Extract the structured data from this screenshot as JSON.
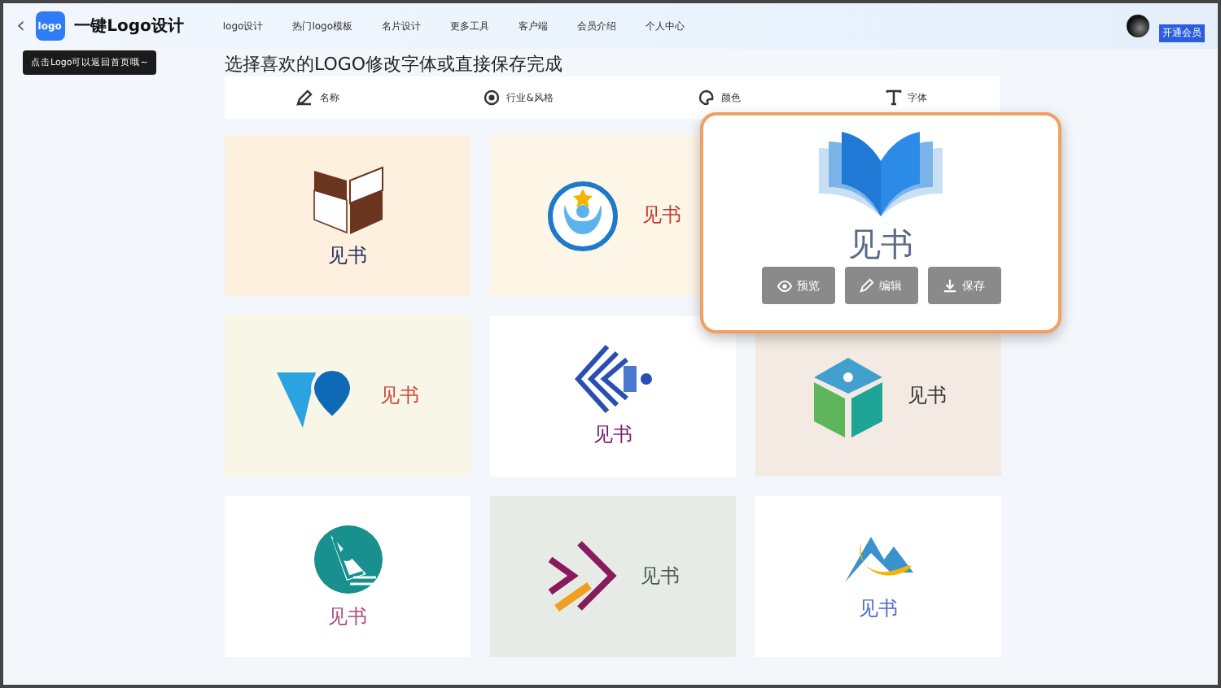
{
  "header": {
    "back": "‹",
    "title": "一键Logo设计",
    "logo_mark": "logo",
    "nav": [
      "logo设计",
      "热门logo模板",
      "名片设计",
      "更多工具",
      "客户端",
      "会员介绍",
      "个人中心"
    ],
    "badge": "开通会员"
  },
  "tooltip": "点击Logo可以返回首页哦~",
  "heading": "选择喜欢的LOGO修改字体或直接保存完成",
  "tabs": [
    {
      "label": "名称",
      "kind": "pen"
    },
    {
      "label": "行业&风格",
      "kind": "target"
    },
    {
      "label": "颜色",
      "kind": "palette"
    },
    {
      "label": "字体",
      "kind": "font"
    }
  ],
  "cards": [
    {
      "name": "见书",
      "kind": "box"
    },
    {
      "name": "见书",
      "kind": "person"
    },
    {
      "name": "见书",
      "kind": "drop"
    },
    {
      "name": "见书",
      "kind": "chevrons"
    },
    {
      "name": "见书",
      "kind": "cube"
    },
    {
      "name": "见书",
      "kind": "nib"
    },
    {
      "name": "见书",
      "kind": "arrows"
    },
    {
      "name": "见书",
      "kind": "mountain"
    }
  ],
  "hover_card": {
    "name": "见书",
    "buttons": [
      {
        "label": "预览",
        "kind": "eye"
      },
      {
        "label": "编辑",
        "kind": "pen"
      },
      {
        "label": "保存",
        "kind": "download"
      }
    ]
  }
}
